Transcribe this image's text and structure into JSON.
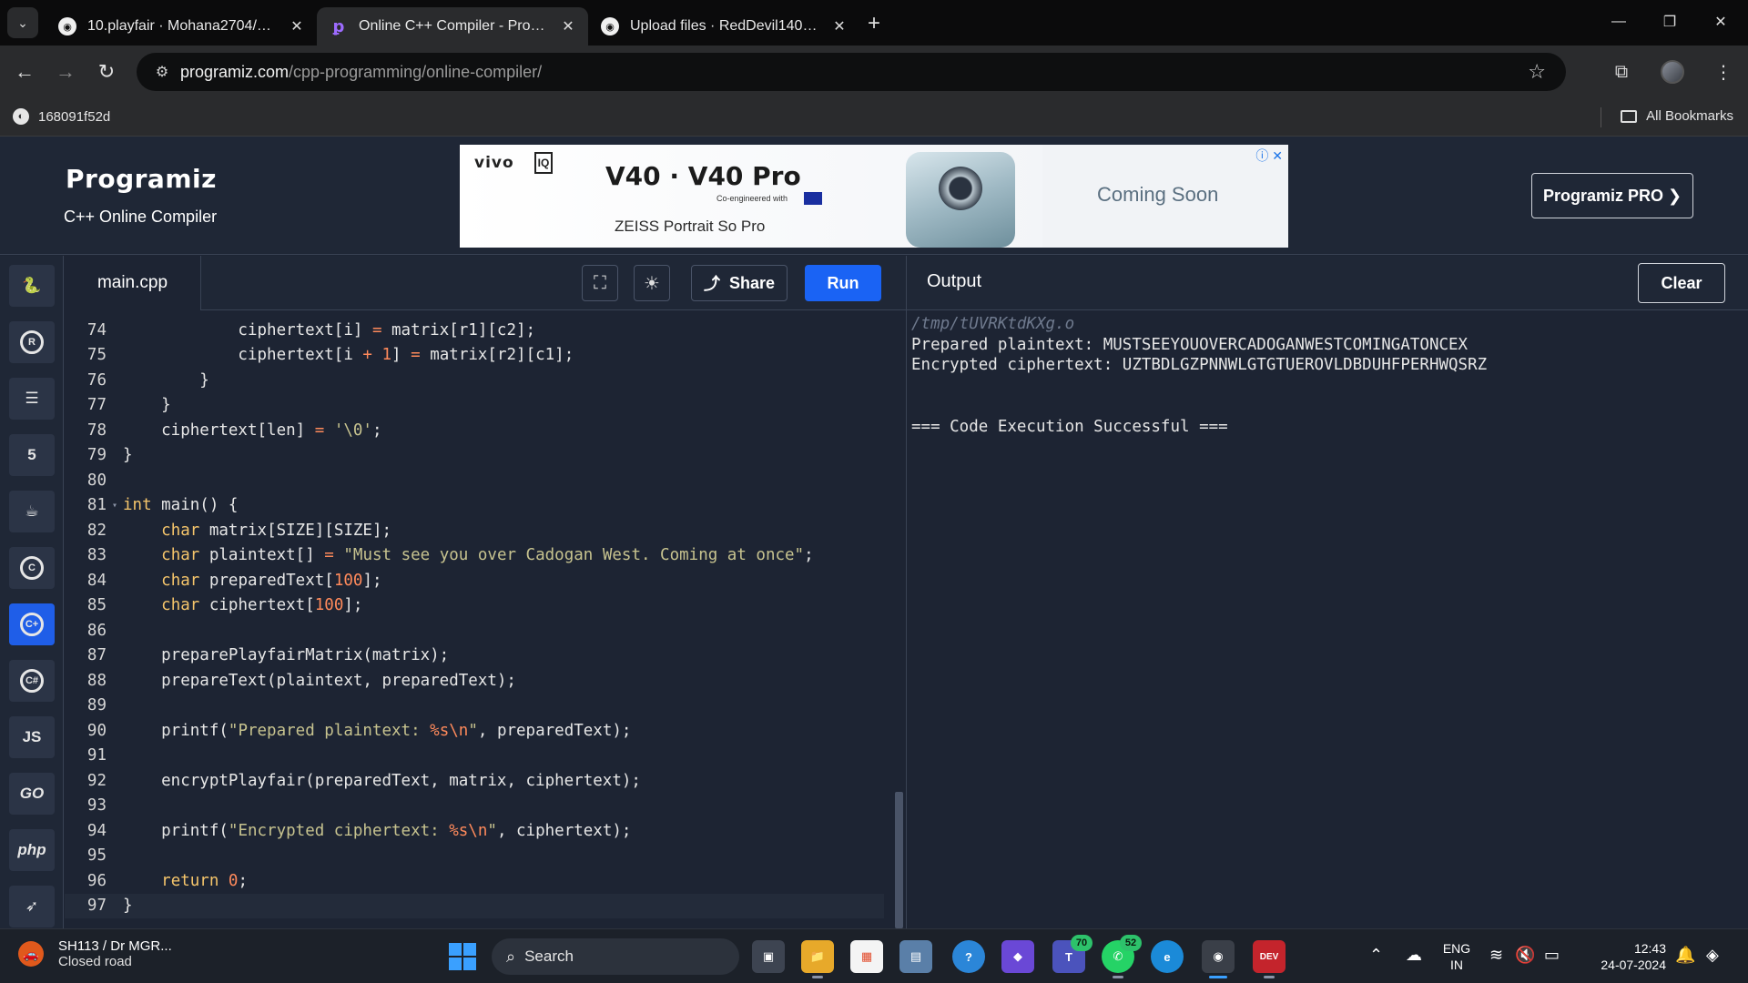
{
  "browser": {
    "tabs": [
      {
        "title": "10.playfair · Mohana2704/CSA5",
        "favicon": "github-icon"
      },
      {
        "title": "Online C++ Compiler - Programiz",
        "favicon": "programiz-icon"
      },
      {
        "title": "Upload files · RedDevil1402/CSA",
        "favicon": "github-icon"
      }
    ],
    "url_host": "programiz.com",
    "url_path": "/cpp-programming/online-compiler/",
    "bookmark_left": "168091f52d",
    "bookmark_right": "All Bookmarks"
  },
  "header": {
    "logo": "Programiz",
    "subtitle": "C++ Online Compiler",
    "pro_button": "Programiz PRO ❯",
    "ad": {
      "brand": "vivo",
      "title": "V40 · V40 Pro",
      "tagline": "Co-engineered with",
      "sub": "ZEISS Portrait So Pro",
      "right": "Coming Soon"
    }
  },
  "editor": {
    "file": "main.cpp",
    "share": "Share",
    "run": "Run",
    "lines": [
      {
        "n": "74",
        "html": "            ciphertext[i] <span class=\"op\">=</span> matrix[r1][c2];"
      },
      {
        "n": "75",
        "html": "            ciphertext[i <span class=\"op\">+</span> <span class=\"num\">1</span>] <span class=\"op\">=</span> matrix[r2][c1];"
      },
      {
        "n": "76",
        "html": "        }"
      },
      {
        "n": "77",
        "html": "    }"
      },
      {
        "n": "78",
        "html": "    ciphertext[len] <span class=\"op\">=</span> <span class=\"str\">'\\0'</span>;"
      },
      {
        "n": "79",
        "html": "}"
      },
      {
        "n": "80",
        "html": ""
      },
      {
        "n": "81",
        "html": "<span class=\"kw\">int</span> main() {",
        "fold": true
      },
      {
        "n": "82",
        "html": "    <span class=\"kw\">char</span> matrix[SIZE][SIZE];"
      },
      {
        "n": "83",
        "html": "    <span class=\"kw\">char</span> plaintext[] <span class=\"op\">=</span> <span class=\"str\">\"Must see you over Cadogan West. Coming at once\"</span>;"
      },
      {
        "n": "84",
        "html": "    <span class=\"kw\">char</span> preparedText[<span class=\"num\">100</span>];"
      },
      {
        "n": "85",
        "html": "    <span class=\"kw\">char</span> ciphertext[<span class=\"num\">100</span>];"
      },
      {
        "n": "86",
        "html": ""
      },
      {
        "n": "87",
        "html": "    preparePlayfairMatrix(matrix);"
      },
      {
        "n": "88",
        "html": "    prepareText(plaintext, preparedText);"
      },
      {
        "n": "89",
        "html": ""
      },
      {
        "n": "90",
        "html": "    printf(<span class=\"str\">\"Prepared plaintext: </span><span class=\"fmt\">%s\\n</span><span class=\"str\">\"</span>, preparedText);"
      },
      {
        "n": "91",
        "html": ""
      },
      {
        "n": "92",
        "html": "    encryptPlayfair(preparedText, matrix, ciphertext);"
      },
      {
        "n": "93",
        "html": ""
      },
      {
        "n": "94",
        "html": "    printf(<span class=\"str\">\"Encrypted ciphertext: </span><span class=\"fmt\">%s\\n</span><span class=\"str\">\"</span>, ciphertext);"
      },
      {
        "n": "95",
        "html": ""
      },
      {
        "n": "96",
        "html": "    <span class=\"kw\">return</span> <span class=\"num\">0</span>;"
      },
      {
        "n": "97",
        "html": "}",
        "current": true
      }
    ]
  },
  "output": {
    "title": "Output",
    "clear": "Clear",
    "lines": [
      {
        "text": "/tmp/tUVRKtdKXg.o",
        "path": true
      },
      {
        "text": "Prepared plaintext: MUSTSEEYOUOVERCADOGANWESTCOMINGATONCEX"
      },
      {
        "text": "Encrypted ciphertext: UZTBDLGZPNNWLGTGTUEROVLDBDUHFPERHWQSRZ"
      },
      {
        "text": ""
      },
      {
        "text": ""
      },
      {
        "text": "=== Code Execution Successful ==="
      }
    ]
  },
  "languages": [
    "python-icon",
    "r-icon",
    "sql-icon",
    "html-icon",
    "java-icon",
    "c-icon",
    "cpp-icon",
    "csharp-icon",
    "JS",
    "GO",
    "php",
    "swift-icon"
  ],
  "taskbar": {
    "weather_title": "SH113 / Dr MGR...",
    "weather_sub": "Closed road",
    "search": "Search",
    "badge_teams": "70",
    "badge_whatsapp": "52",
    "lang_top": "ENG",
    "lang_bottom": "IN",
    "time": "12:43",
    "date": "24-07-2024"
  }
}
